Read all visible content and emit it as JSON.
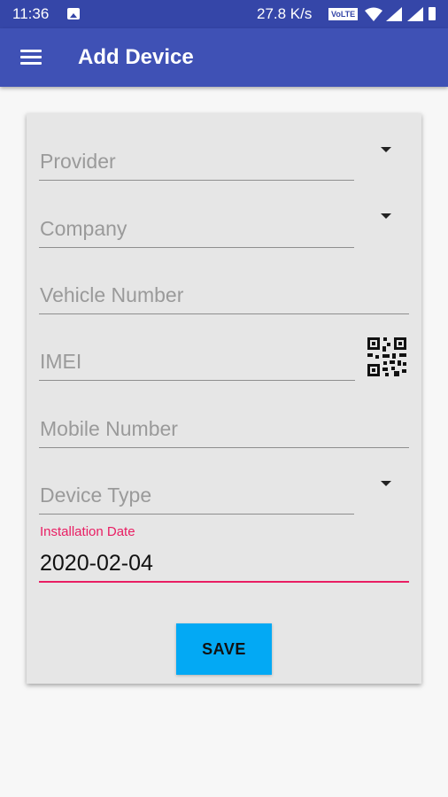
{
  "status_bar": {
    "time": "11:36",
    "net_speed": "27.8 K/s",
    "volte": "VoLTE"
  },
  "app_bar": {
    "title": "Add Device",
    "menu_icon": "hamburger-menu-icon"
  },
  "form": {
    "provider": {
      "placeholder": "Provider"
    },
    "company": {
      "placeholder": "Company"
    },
    "vehicle_number": {
      "placeholder": "Vehicle Number"
    },
    "imei": {
      "placeholder": "IMEI",
      "scan_icon": "qr-code-icon"
    },
    "mobile_number": {
      "placeholder": "Mobile Number"
    },
    "device_type": {
      "placeholder": "Device Type"
    },
    "installation_date": {
      "label": "Installation Date",
      "value": "2020-02-04"
    },
    "save_label": "SAVE"
  },
  "colors": {
    "status_bar": "#3546a8",
    "app_bar": "#3f51b5",
    "accent": "#e91e63",
    "save_button": "#03a9f4"
  }
}
